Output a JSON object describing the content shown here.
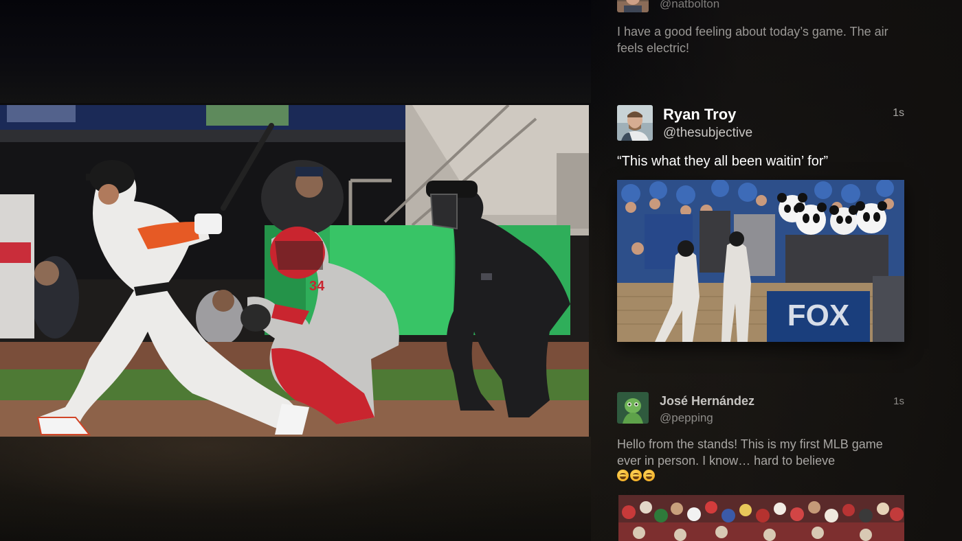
{
  "main_media": {
    "icon": "baseball-game-photo"
  },
  "feed": {
    "posts": [
      {
        "handle": "@natbolton",
        "text": "I have a good feeling about today’s game. The air feels electric!"
      },
      {
        "name": "Ryan Troy",
        "handle": "@thesubjective",
        "time": "1s",
        "text": "“This what they all been waitin’ for”",
        "image_text": "FOX"
      },
      {
        "name": "José Hernández",
        "handle": "@pepping",
        "time": "1s",
        "text": "Hello from the stands! This is my first MLB game ever in person. I know… hard to believe",
        "emojis": [
          "grinning-sweat-emoji",
          "grinning-sweat-emoji",
          "squinting-tongue-emoji"
        ]
      }
    ]
  },
  "colors": {
    "background": "#0c0b0a",
    "name_focused": "#ffffff",
    "text_muted": "#a8a6a3"
  }
}
